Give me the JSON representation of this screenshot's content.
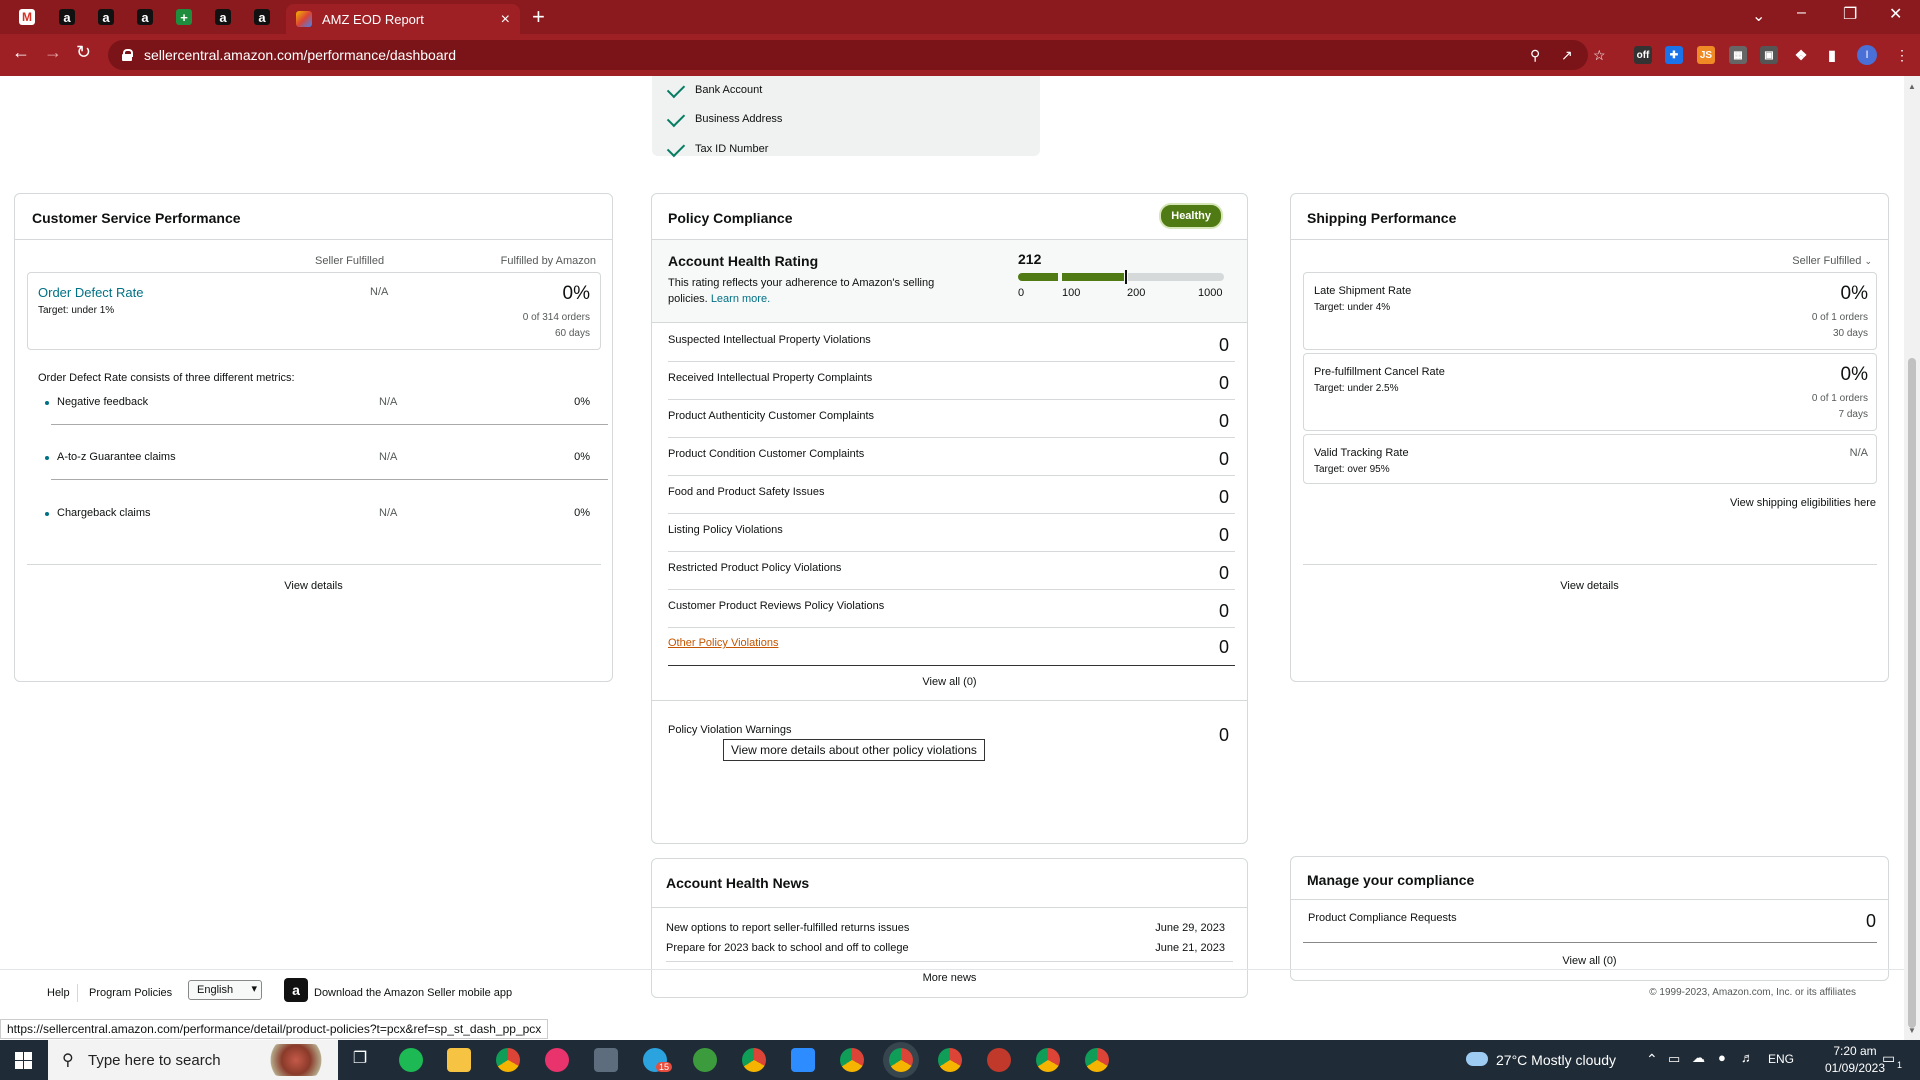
{
  "browser": {
    "active_tab_title": "AMZ EOD Report",
    "url": "sellercentral.amazon.com/performance/dashboard",
    "tab_close": "×",
    "new_tab": "+",
    "status_url": "https://sellercentral.amazon.com/performance/detail/product-policies?t=pcx&ref=sp_st_dash_pp_pcx",
    "profile_initial": "I"
  },
  "verification": {
    "items": [
      "Bank Account",
      "Business Address",
      "Tax ID Number"
    ]
  },
  "customer_service": {
    "title": "Customer Service Performance",
    "col_seller": "Seller Fulfilled",
    "col_fba": "Fulfilled by Amazon",
    "odr_label": "Order Defect Rate",
    "odr_target": "Target: under 1%",
    "odr_seller": "N/A",
    "odr_fba": "0%",
    "odr_orders": "0 of 314 orders",
    "odr_days": "60 days",
    "consists_text": "Order Defect Rate consists of three different metrics:",
    "metrics": [
      {
        "label": "Negative feedback",
        "seller": "N/A",
        "fba": "0%"
      },
      {
        "label": "A-to-z Guarantee claims",
        "seller": "N/A",
        "fba": "0%"
      },
      {
        "label": "Chargeback claims",
        "seller": "N/A",
        "fba": "0%"
      }
    ],
    "view_details": "View details"
  },
  "policy": {
    "title": "Policy Compliance",
    "badge": "Healthy",
    "ahr_title": "Account Health Rating",
    "ahr_desc_1": "This rating reflects your adherence to Amazon's selling",
    "ahr_desc_2": "policies.",
    "learn_more": "Learn more.",
    "ahr_value": "212",
    "ahr_level": 0.212,
    "scale": [
      "0",
      "100",
      "200",
      "1000"
    ],
    "rows": [
      {
        "label": "Suspected Intellectual Property Violations",
        "count": "0"
      },
      {
        "label": "Received Intellectual Property Complaints",
        "count": "0"
      },
      {
        "label": "Product Authenticity Customer Complaints",
        "count": "0"
      },
      {
        "label": "Product Condition Customer Complaints",
        "count": "0"
      },
      {
        "label": "Food and Product Safety Issues",
        "count": "0"
      },
      {
        "label": "Listing Policy Violations",
        "count": "0"
      },
      {
        "label": "Restricted Product Policy Violations",
        "count": "0"
      },
      {
        "label": "Customer Product Reviews Policy Violations",
        "count": "0"
      },
      {
        "label": "Other Policy Violations",
        "count": "0"
      }
    ],
    "tooltip": "View more details about other policy violations",
    "view_all": "View all (0)",
    "warnings_label": "Policy Violation Warnings",
    "warnings_count": "0",
    "badge_color": "#507a13"
  },
  "shipping": {
    "title": "Shipping Performance",
    "filter": "Seller Fulfilled",
    "metrics": [
      {
        "label": "Late Shipment Rate",
        "target": "Target: under 4%",
        "value": "0%",
        "orders": "0 of 1 orders",
        "days": "30 days"
      },
      {
        "label": "Pre-fulfillment Cancel Rate",
        "target": "Target: under 2.5%",
        "value": "0%",
        "orders": "0 of 1 orders",
        "days": "7 days"
      },
      {
        "label": "Valid Tracking Rate",
        "target": "Target: over 95%",
        "value": "N/A"
      }
    ],
    "eligibilities": "View shipping eligibilities here",
    "view_details": "View details"
  },
  "news": {
    "title": "Account Health News",
    "items": [
      {
        "label": "New options to report seller-fulfilled returns issues",
        "date": "June 29, 2023"
      },
      {
        "label": "Prepare for 2023 back to school and off to college",
        "date": "June 21, 2023"
      }
    ],
    "more": "More news"
  },
  "compliance": {
    "title": "Manage your compliance",
    "row_label": "Product Compliance Requests",
    "row_count": "0",
    "view_all": "View all (0)"
  },
  "footer": {
    "help": "Help",
    "policies": "Program Policies",
    "language": "English",
    "app": "Download the Amazon Seller mobile app",
    "copyright": "© 1999-2023, Amazon.com, Inc. or its affiliates"
  },
  "taskbar": {
    "search_placeholder": "Type here to search",
    "weather": "27°C  Mostly cloudy",
    "lang": "ENG",
    "time": "7:20 am",
    "date": "01/09/2023",
    "badge": "15",
    "notif_count": "1"
  }
}
